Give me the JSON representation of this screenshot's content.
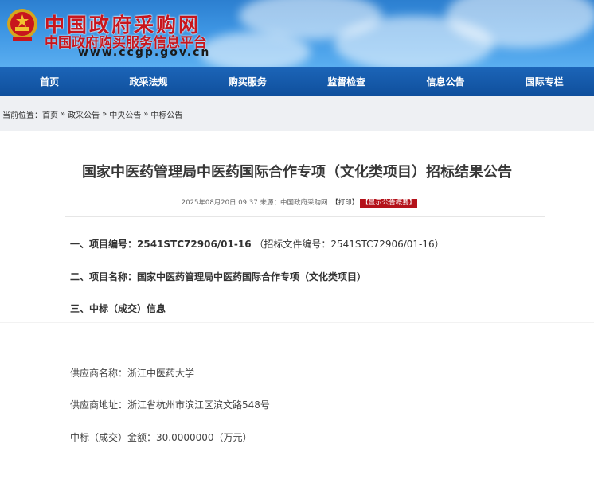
{
  "header": {
    "title": "中国政府采购网",
    "subtitle": "中国政府购买服务信息平台",
    "url": "www.ccgp.gov.cn",
    "emblem_icon": "national-emblem-icon"
  },
  "nav": {
    "items": [
      "首页",
      "政采法规",
      "购买服务",
      "监督检查",
      "信息公告",
      "国际专栏"
    ]
  },
  "breadcrumb": {
    "prefix": "当前位置：",
    "items": [
      "首页",
      "政采公告",
      "中央公告",
      "中标公告"
    ],
    "separator": "»"
  },
  "article": {
    "title": "国家中医药管理局中医药国际合作专项（文化类项目）招标结果公告",
    "datetime": "2025年08月20日 09:37",
    "source_label": "来源：",
    "source": "中国政府采购网",
    "print_label": "【打印】",
    "summary_badge": "【显示公告概要】",
    "sections": {
      "s1_label": "一、项目编号：",
      "s1_value": "2541STC72906/01-16",
      "s1_extra": "（招标文件编号：2541STC72906/01-16）",
      "s2_label": "二、项目名称：",
      "s2_value": "国家中医药管理局中医药国际合作专项（文化类项目）",
      "s3_label": "三、中标（成交）信息"
    },
    "winner": {
      "name_label": "供应商名称：",
      "name": "浙江中医药大学",
      "address_label": "供应商地址：",
      "address": "浙江省杭州市滨江区滨文路548号",
      "amount_label": "中标（成交）金额：",
      "amount": "30.0000000（万元）"
    }
  },
  "colors": {
    "brand_red": "#c8161d",
    "nav_blue": "#1c65b8",
    "badge_red": "#b4121a"
  }
}
